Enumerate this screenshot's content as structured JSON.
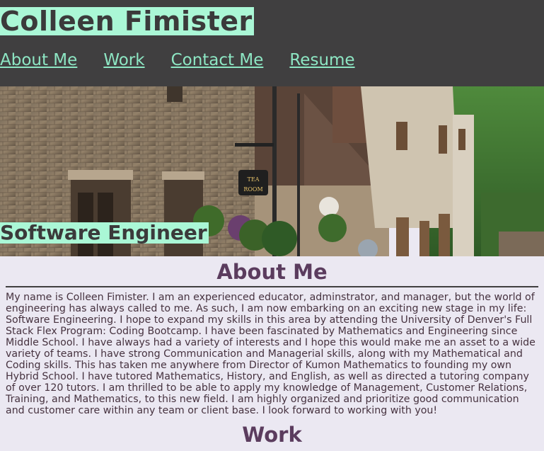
{
  "header": {
    "name": "Colleen Fimister",
    "nav": [
      {
        "label": "About Me"
      },
      {
        "label": "Work"
      },
      {
        "label": "Contact Me"
      },
      {
        "label": "Resume"
      }
    ]
  },
  "hero": {
    "role": "Software Engineer",
    "sign_text": "TEA ROOM"
  },
  "about": {
    "heading": "About Me",
    "text": "My name is Colleen Fimister. I am an experienced educator, adminstrator, and manager, but the world of engineering has always called to me. As such, I am now embarking on an exciting new stage in my life: Software Engineering. I hope to expand my skills in this area by attending the University of Denver's Full Stack Flex Program: Coding Bootcamp. I have been fascinated by Mathematics and Engineering since Middle School. I have always had a variety of interests and I hope this would make me an asset to a wide variety of teams. I have strong Communication and Managerial skills, along with my Mathematical and Coding skills. This has taken me anywhere from Director of Kumon Mathematics to founding my own Hybrid School. I have tutored Mathematics, History, and English, as well as directed a tutoring company of over 120 tutors. I am thrilled to be able to apply my knowledge of Management, Customer Relations, Training, and Mathematics, to this new field. I am highly organized and prioritize good communication and customer care within any team or client base. I look forward to working with you!"
  },
  "work": {
    "heading": "Work"
  }
}
